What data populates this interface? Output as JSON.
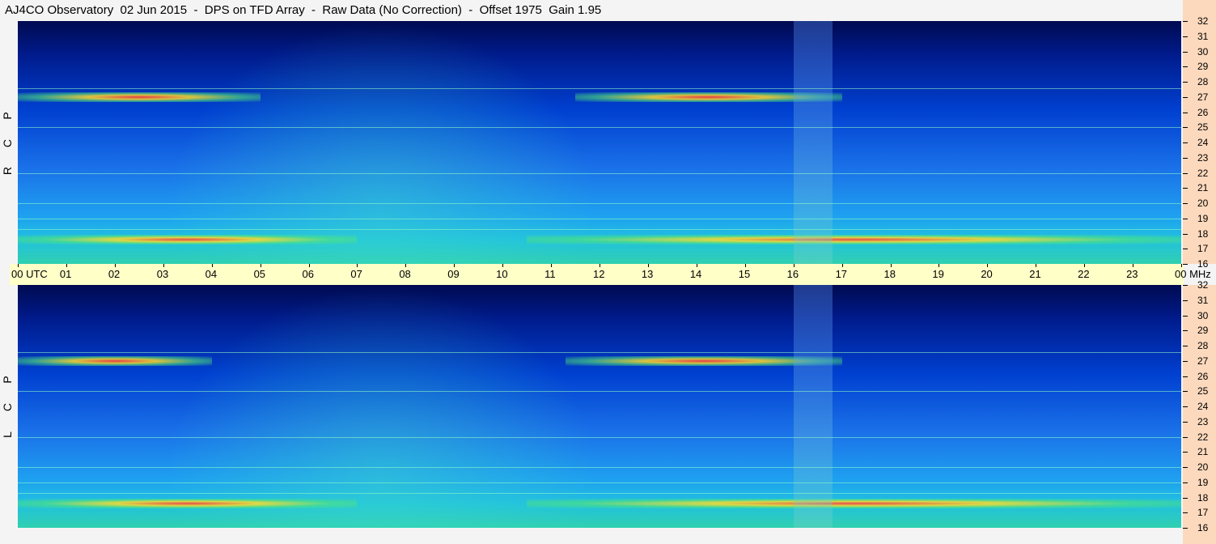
{
  "page_title": "AJ4CO Observatory  02 Jun 2015  -  DPS on TFD Array  -  Raw Data (No Correction)  -  Offset 1975  Gain 1.95",
  "colors": {
    "background": "#f4f4f4",
    "time_strip": "#ffffc8",
    "freq_axis": "#fcd9bd",
    "spectrogram_low": "#00007f",
    "spectrogram_mid": "#1e90ff",
    "spectrogram_high": "#ff3030"
  },
  "time_axis": {
    "unit_label": "UTC",
    "labels": [
      "00",
      "01",
      "02",
      "03",
      "04",
      "05",
      "06",
      "07",
      "08",
      "09",
      "10",
      "11",
      "12",
      "13",
      "14",
      "15",
      "16",
      "17",
      "18",
      "19",
      "20",
      "21",
      "22",
      "23",
      "00"
    ]
  },
  "freq_axis": {
    "unit_label": "MHz",
    "labels": [
      "32",
      "31",
      "30",
      "29",
      "28",
      "27",
      "26",
      "25",
      "24",
      "23",
      "22",
      "21",
      "20",
      "19",
      "18",
      "17",
      "16"
    ]
  },
  "chart_data": [
    {
      "type": "heatmap",
      "panel": "RCP",
      "polarization_label": [
        "R",
        "C",
        "P"
      ],
      "x_range_utc_hours": [
        0,
        24
      ],
      "y_range_mhz": [
        16,
        32
      ],
      "features": [
        {
          "desc": "strong emission band",
          "freq_mhz": 27,
          "utc": [
            0,
            5
          ]
        },
        {
          "desc": "strong emission band",
          "freq_mhz": 27,
          "utc": [
            11.5,
            17
          ]
        },
        {
          "desc": "strong emission band",
          "freq_mhz": 17.6,
          "utc": [
            0,
            7
          ]
        },
        {
          "desc": "strong emission band",
          "freq_mhz": 17.6,
          "utc": [
            10.5,
            24
          ]
        },
        {
          "desc": "broadband vertical stripe",
          "utc": [
            16.0,
            16.8
          ]
        }
      ]
    },
    {
      "type": "heatmap",
      "panel": "LCP",
      "polarization_label": [
        "L",
        "C",
        "P"
      ],
      "x_range_utc_hours": [
        0,
        24
      ],
      "y_range_mhz": [
        16,
        32
      ],
      "features": [
        {
          "desc": "strong emission band",
          "freq_mhz": 27,
          "utc": [
            0,
            4
          ]
        },
        {
          "desc": "strong emission band",
          "freq_mhz": 27,
          "utc": [
            11.3,
            17
          ]
        },
        {
          "desc": "strong emission band",
          "freq_mhz": 17.6,
          "utc": [
            0,
            7
          ]
        },
        {
          "desc": "strong emission band",
          "freq_mhz": 17.6,
          "utc": [
            10.5,
            24
          ]
        },
        {
          "desc": "broadband vertical stripe",
          "utc": [
            16.0,
            16.8
          ]
        }
      ]
    }
  ]
}
